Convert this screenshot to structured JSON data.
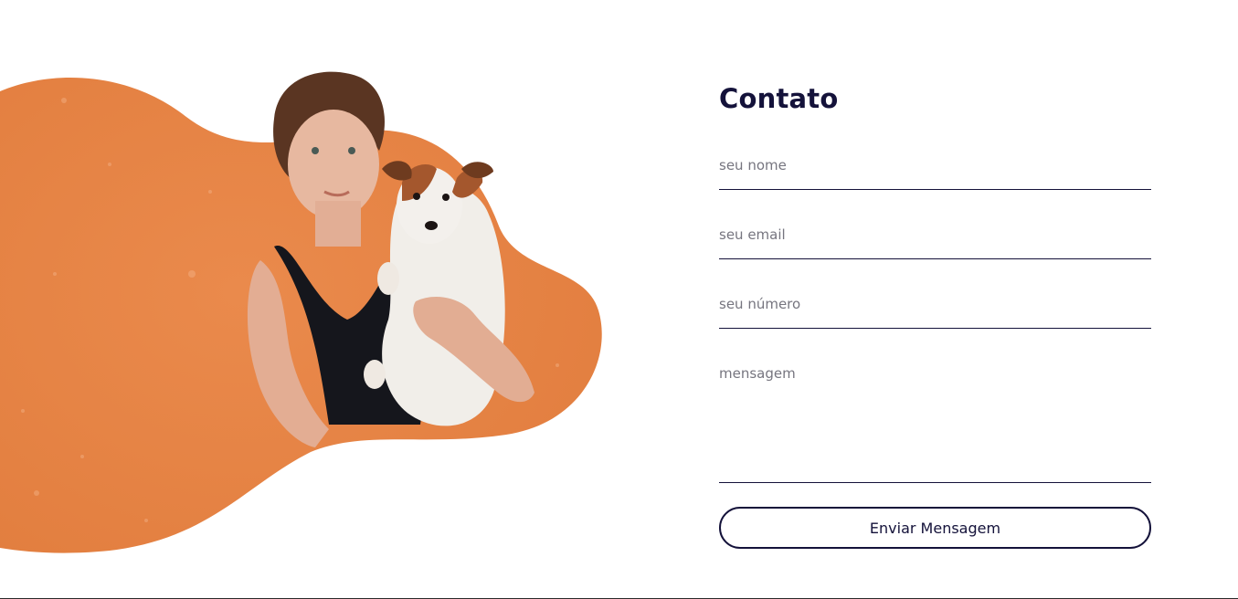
{
  "contact": {
    "title": "Contato",
    "fields": {
      "name_placeholder": "seu nome",
      "email_placeholder": "seu email",
      "phone_placeholder": "seu número",
      "message_placeholder": "mensagem"
    },
    "submit_label": "Enviar Mensagem"
  },
  "colors": {
    "accent_orange": "#e8874a",
    "text_dark": "#14123a",
    "placeholder": "#76757f",
    "background": "#ffffff"
  },
  "hero_image": {
    "subject": "woman holding a dog over orange blob"
  }
}
